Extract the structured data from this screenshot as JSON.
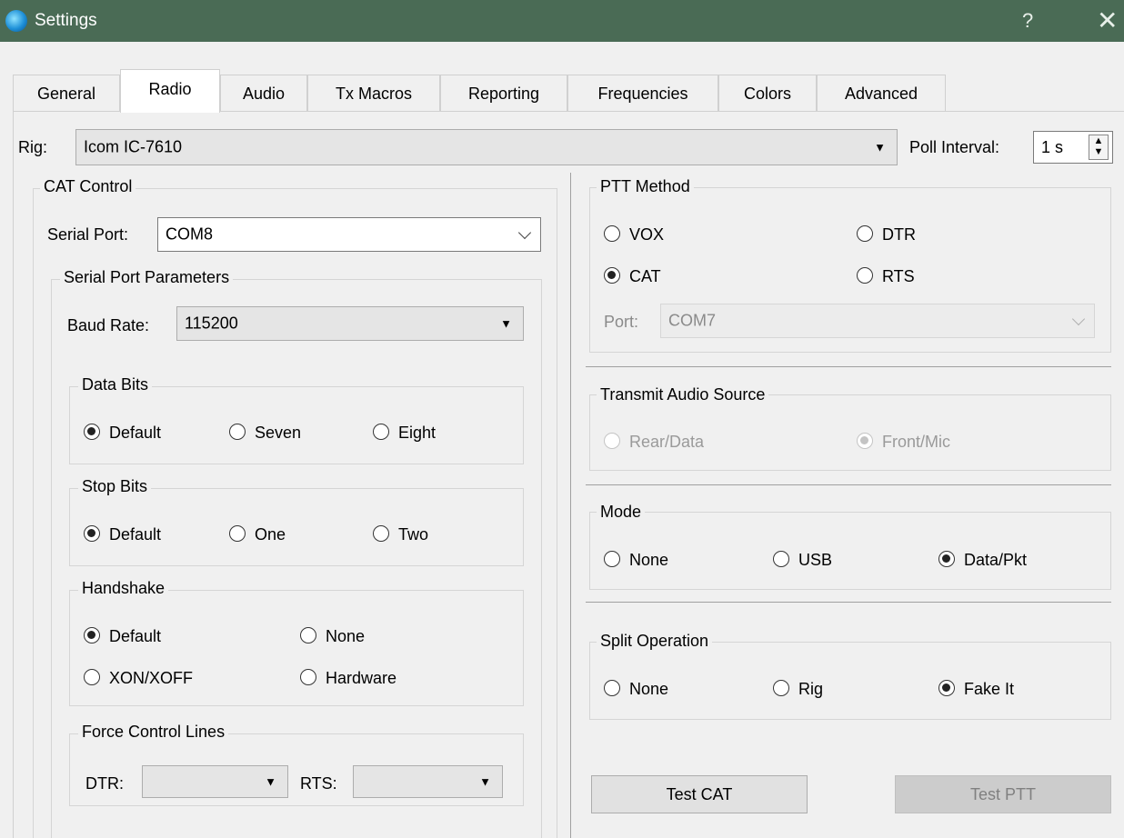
{
  "window": {
    "title": "Settings",
    "help": "?",
    "close": "✕"
  },
  "tabs": [
    "General",
    "Radio",
    "Audio",
    "Tx Macros",
    "Reporting",
    "Frequencies",
    "Colors",
    "Advanced"
  ],
  "rig": {
    "label": "Rig:",
    "value": "Icom IC-7610",
    "poll_label": "Poll Interval:",
    "poll_value": "1 s"
  },
  "cat": {
    "title": "CAT Control",
    "serial_port_label": "Serial Port:",
    "serial_port_value": "COM8",
    "params_title": "Serial Port Parameters",
    "baud_label": "Baud Rate:",
    "baud_value": "115200",
    "data_bits": {
      "title": "Data Bits",
      "options": [
        "Default",
        "Seven",
        "Eight"
      ],
      "selected": "Default"
    },
    "stop_bits": {
      "title": "Stop Bits",
      "options": [
        "Default",
        "One",
        "Two"
      ],
      "selected": "Default"
    },
    "handshake": {
      "title": "Handshake",
      "options": [
        "Default",
        "None",
        "XON/XOFF",
        "Hardware"
      ],
      "selected": "Default"
    },
    "force": {
      "title": "Force Control Lines",
      "dtr_label": "DTR:",
      "rts_label": "RTS:"
    }
  },
  "ptt": {
    "title": "PTT Method",
    "options": [
      "VOX",
      "DTR",
      "CAT",
      "RTS"
    ],
    "selected": "CAT",
    "port_label": "Port:",
    "port_value": "COM7"
  },
  "tx_audio": {
    "title": "Transmit Audio Source",
    "options": [
      "Rear/Data",
      "Front/Mic"
    ],
    "selected": "Front/Mic"
  },
  "mode": {
    "title": "Mode",
    "options": [
      "None",
      "USB",
      "Data/Pkt"
    ],
    "selected": "Data/Pkt"
  },
  "split": {
    "title": "Split Operation",
    "options": [
      "None",
      "Rig",
      "Fake It"
    ],
    "selected": "Fake It"
  },
  "buttons": {
    "test_cat": "Test CAT",
    "test_ptt": "Test PTT"
  }
}
